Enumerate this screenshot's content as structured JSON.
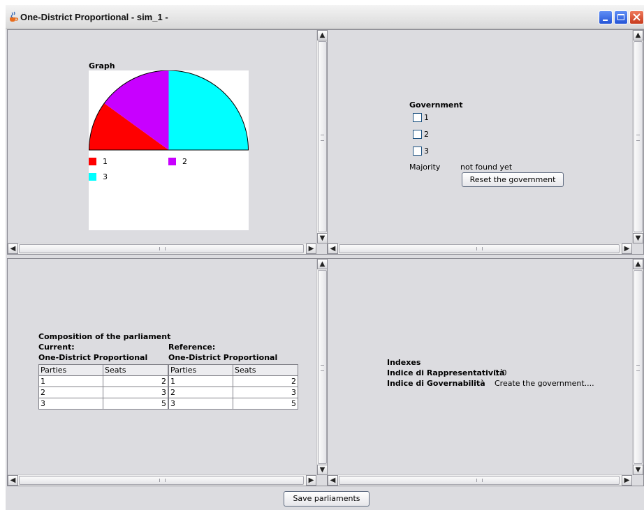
{
  "window": {
    "title": "One-District Proportional - sim_1 -"
  },
  "graph_panel": {
    "title": "Graph",
    "legend": [
      {
        "label": "1",
        "color": "#ff0000"
      },
      {
        "label": "2",
        "color": "#c800ff"
      },
      {
        "label": "3",
        "color": "#00ffff"
      }
    ]
  },
  "chart_data": {
    "type": "pie",
    "title": "Graph",
    "categories": [
      "1",
      "2",
      "3"
    ],
    "values": [
      2,
      3,
      5
    ],
    "colors": [
      "#ff0000",
      "#c800ff",
      "#00ffff"
    ],
    "shape": "half-pie (semicircle)",
    "legend_position": "bottom"
  },
  "government_panel": {
    "title": "Government",
    "checkboxes": [
      {
        "label": "1",
        "checked": false
      },
      {
        "label": "2",
        "checked": false
      },
      {
        "label": "3",
        "checked": false
      }
    ],
    "majority_label": "Majority",
    "majority_value": "not found yet",
    "reset_button": "Reset the government"
  },
  "composition_panel": {
    "title": "Composition of the parliament",
    "current": {
      "heading": "Current:",
      "subheading": "One-District Proportional",
      "columns": [
        "Parties",
        "Seats"
      ],
      "rows": [
        [
          "1",
          "2"
        ],
        [
          "2",
          "3"
        ],
        [
          "3",
          "5"
        ]
      ]
    },
    "reference": {
      "heading": "Reference:",
      "subheading": "One-District Proportional",
      "columns": [
        "Parties",
        "Seats"
      ],
      "rows": [
        [
          "1",
          "2"
        ],
        [
          "2",
          "3"
        ],
        [
          "3",
          "5"
        ]
      ]
    }
  },
  "indexes_panel": {
    "title": "Indexes",
    "rappresentativita_label": "Indice di Rappresentatività",
    "rappresentativita_value": "1.0",
    "governabilita_label": "Indice di Governabilità",
    "governabilita_value": "Create the government...."
  },
  "footer": {
    "save_button": "Save parliaments"
  }
}
